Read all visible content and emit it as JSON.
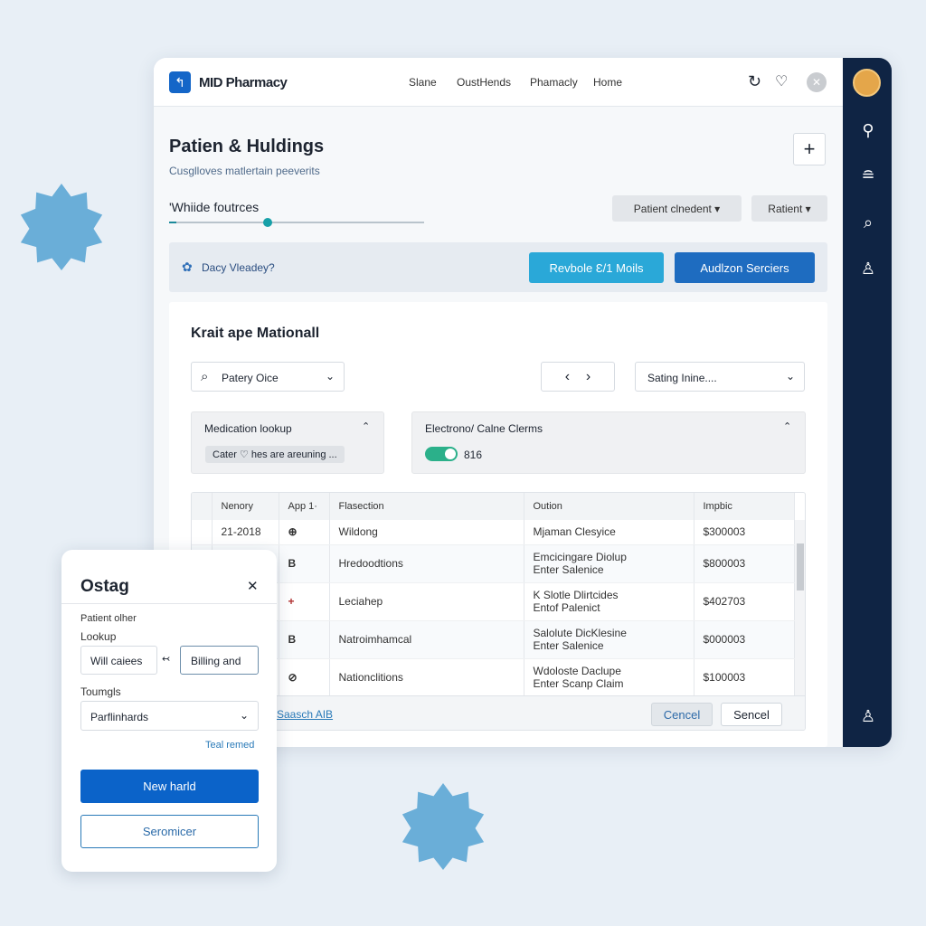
{
  "app": {
    "title": "MID Pharmacy",
    "nav": [
      "Slane",
      "OustHends",
      "Phamacly",
      "Home"
    ]
  },
  "page": {
    "title": "Patien & Huldings",
    "subtitle": "Cusglloves matlertain peeverits",
    "slider_label": "'Whiide foutrces",
    "slider_value": 0.4,
    "dropdown1": "Patient clnedent",
    "dropdown2": "Ratient"
  },
  "banner": {
    "text": "Dacy Vleadey?",
    "btn1": "Revbole Ɛ/1 Moils",
    "btn2": "Audlzon Serciers"
  },
  "section": {
    "title": "Krait ape Mationall",
    "search": "Patery Oice",
    "sort": "Sating Inine....",
    "panel1": {
      "title": "Medication lookup",
      "chip": "Cater ♡ hes are areuning ..."
    },
    "panel2": {
      "title": "Electrono/ Calne Clerms",
      "toggle_on": true,
      "toggle_label": "816"
    }
  },
  "table": {
    "headers": [
      "Nenory",
      "App 1·",
      "Flasection",
      "Oution",
      "Impbic"
    ],
    "rows": [
      [
        "21-2018",
        "⊕",
        "Wildong",
        "Mjaman Clesyice",
        "",
        "$300003"
      ],
      [
        "",
        "B",
        "Hredoodtions",
        "Emcicingare Diolup",
        "Enter Salenice",
        "$800003"
      ],
      [
        "",
        "+",
        "Leciahep",
        "K Slotle Dlirtcides",
        "Entof Palenict",
        "$402703"
      ],
      [
        "",
        "B",
        "Natroimhamcal",
        "Salolute DicKlesine",
        "Enter Salenice",
        "$000003"
      ],
      [
        "",
        "⊘",
        "Nationclitions",
        "Wdoloste Daclupe",
        "Enter Scanp Claim",
        "$100003"
      ]
    ],
    "link": "Saasch AIB",
    "cancel": "Cencel",
    "send": "Sencel"
  },
  "modal": {
    "title": "Ostag",
    "label1": "Patient olher",
    "label2": "Lookup",
    "input1": "Will caiees",
    "input2": "Billing and",
    "label3": "Toumgls",
    "select": "Parflinhards",
    "link": "Teal remed",
    "primary": "New harld",
    "secondary": "Seromicer"
  },
  "colors": {
    "accent": "#0b63c9",
    "teal": "#2aa8d8",
    "sidebar": "#0f2444",
    "toggle": "#2bb08a"
  }
}
